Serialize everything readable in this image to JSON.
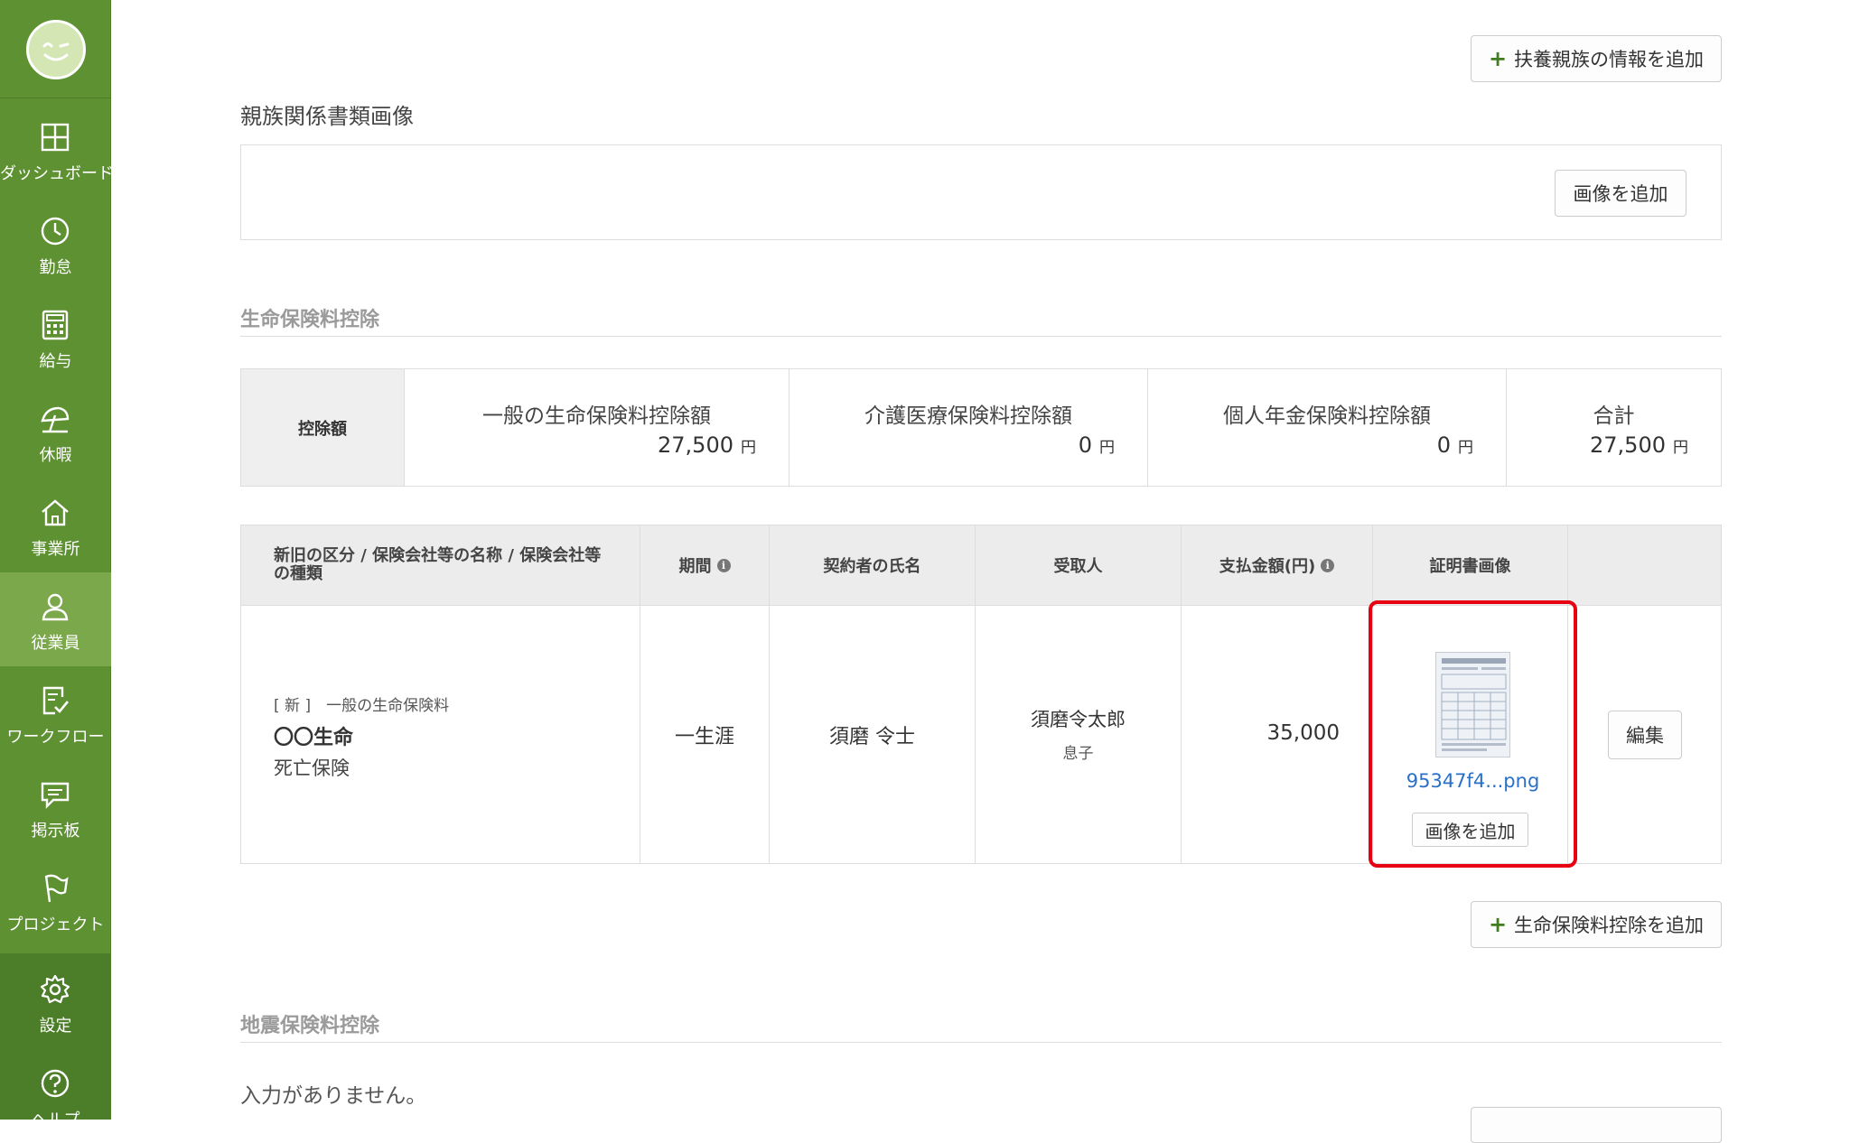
{
  "sidebar": {
    "items": [
      {
        "label": "ダッシュボード",
        "icon": "dashboard-icon"
      },
      {
        "label": "勤怠",
        "icon": "clock-icon"
      },
      {
        "label": "給与",
        "icon": "calculator-icon"
      },
      {
        "label": "休暇",
        "icon": "umbrella-icon"
      },
      {
        "label": "事業所",
        "icon": "home-icon"
      },
      {
        "label": "従業員",
        "icon": "person-icon"
      },
      {
        "label": "ワークフロー",
        "icon": "checklist-icon"
      },
      {
        "label": "掲示板",
        "icon": "chat-icon"
      },
      {
        "label": "プロジェクト",
        "icon": "flag-icon"
      },
      {
        "label": "設定",
        "icon": "gear-icon"
      },
      {
        "label": "ヘルプ",
        "icon": "help-icon"
      }
    ],
    "active_index": 5
  },
  "dependents": {
    "add_button": "扶養親族の情報を追加"
  },
  "relation_docs": {
    "title": "親族関係書類画像",
    "add_image_button": "画像を追加"
  },
  "life_insurance": {
    "title": "生命保険料控除",
    "summary": {
      "row_label": "控除額",
      "columns": [
        {
          "title": "一般の生命保険料控除額",
          "value": "27,500",
          "unit": "円"
        },
        {
          "title": "介護医療保険料控除額",
          "value": "0",
          "unit": "円"
        },
        {
          "title": "個人年金保険料控除額",
          "value": "0",
          "unit": "円"
        },
        {
          "title": "合計",
          "value": "27,500",
          "unit": "円"
        }
      ]
    },
    "table": {
      "headers": {
        "category": "新旧の区分 / 保険会社等の名称 / 保険会社等の種類",
        "period": "期間",
        "contractor": "契約者の氏名",
        "recipient": "受取人",
        "amount": "支払金額(円)",
        "certificate": "証明書画像"
      },
      "row": {
        "kind": "[ 新 ]　一般の生命保険料",
        "company": "〇〇生命",
        "type": "死亡保険",
        "period": "一生涯",
        "contractor": "須磨 令士",
        "recipient_name": "須磨令太郎",
        "recipient_relation": "息子",
        "amount": "35,000",
        "file_name": "95347f4...png",
        "add_image_button": "画像を追加",
        "edit_button": "編集"
      }
    },
    "add_button": "生命保険料控除を追加"
  },
  "earthquake": {
    "title": "地震保険料控除",
    "empty_text": "入力がありません。"
  },
  "colors": {
    "sidebar": "#5e9132",
    "sidebar_active": "#7aa84a",
    "highlight": "#e60012",
    "link": "#2a70c8",
    "plus": "#3f7d1f"
  }
}
